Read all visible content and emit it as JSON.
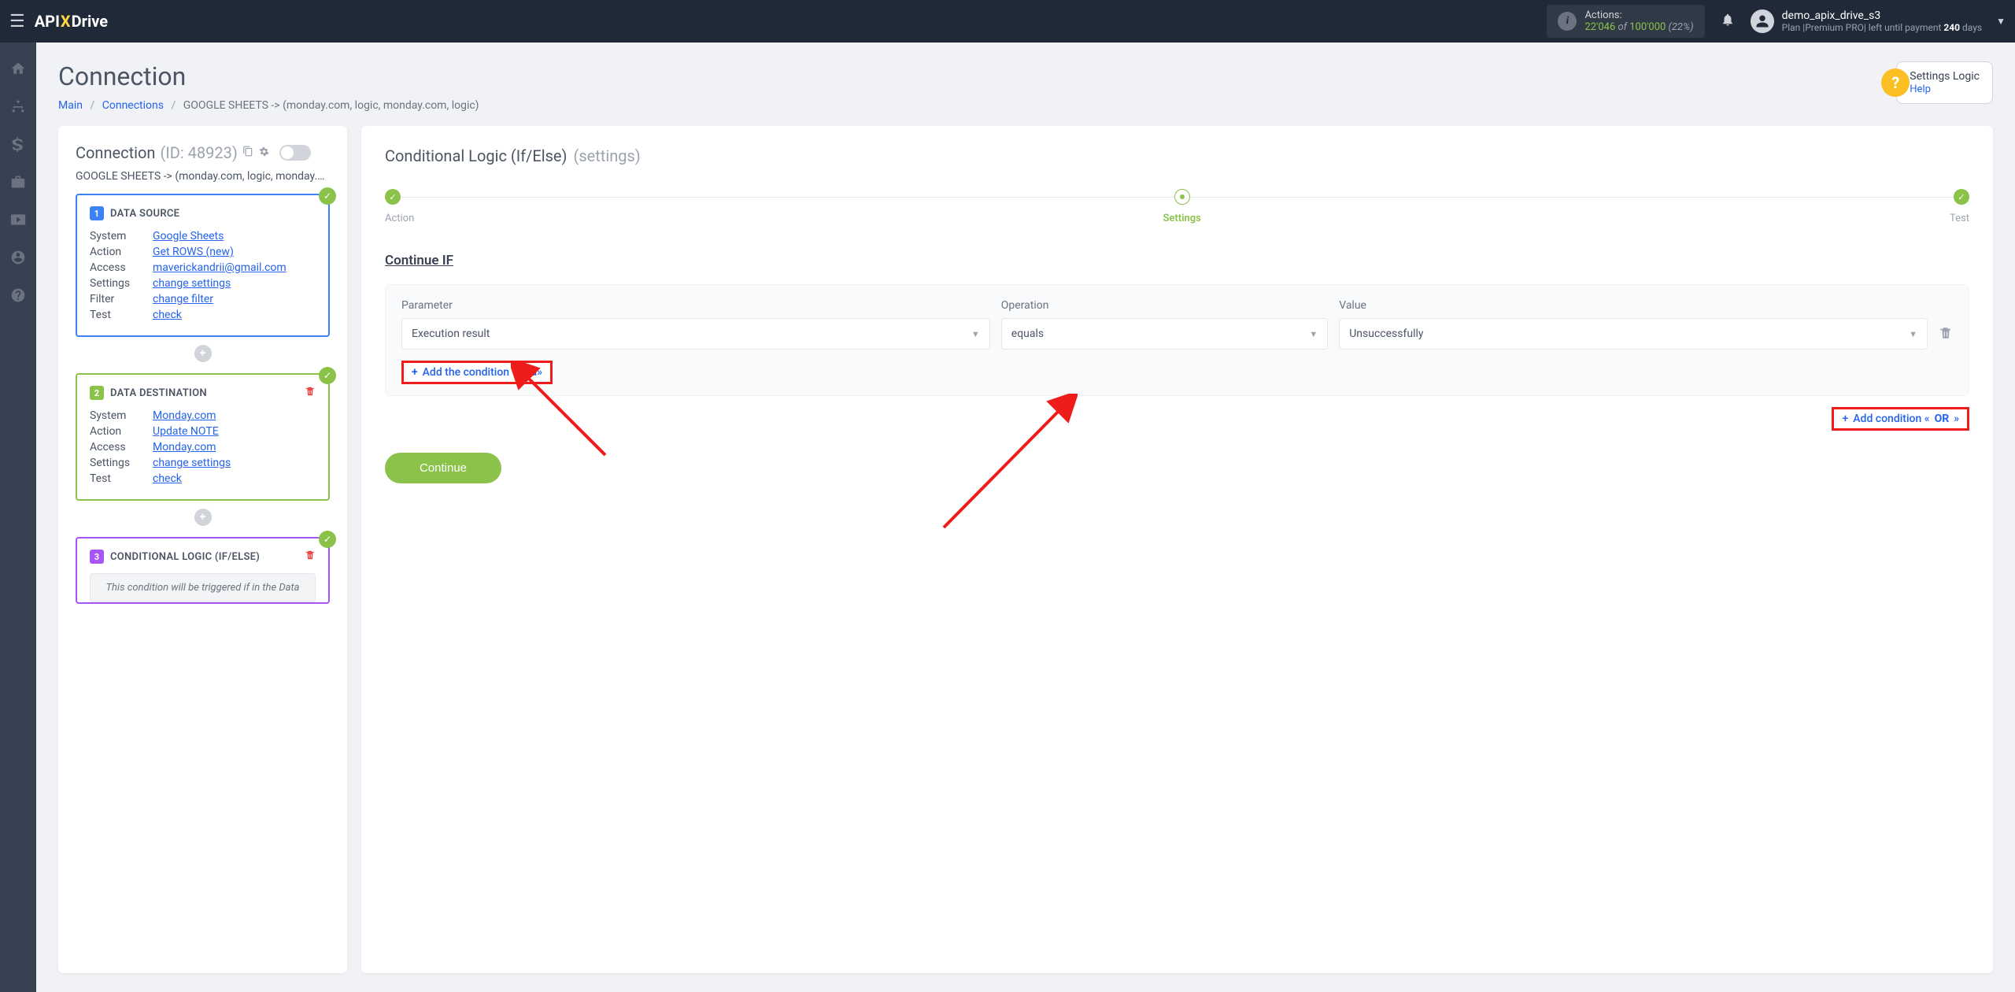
{
  "topbar": {
    "logo_pre": "API",
    "logo_x": "X",
    "logo_post": "Drive",
    "actions_label": "Actions:",
    "actions_used": "22'046",
    "actions_of": " of ",
    "actions_total": "100'000",
    "actions_pct": " (22%)",
    "user_name": "demo_apix_drive_s3",
    "user_plan_pre": "Plan |Premium PRO| left until payment ",
    "user_plan_days": "240",
    "user_plan_post": " days"
  },
  "page": {
    "title": "Connection",
    "breadcrumb": {
      "main": "Main",
      "connections": "Connections",
      "current": "GOOGLE SHEETS -> (monday.com, logic, monday.com, logic)"
    }
  },
  "help_box": {
    "title": "Settings Logic",
    "link": "Help"
  },
  "left_panel": {
    "title": "Connection",
    "id": "(ID: 48923)",
    "sub_name": "GOOGLE SHEETS -> (monday.com, logic, monday.com, logic)",
    "cards": {
      "source": {
        "num": "1",
        "title": "DATA SOURCE",
        "rows": [
          {
            "label": "System",
            "value": "Google Sheets"
          },
          {
            "label": "Action",
            "value": "Get ROWS (new)"
          },
          {
            "label": "Access",
            "value": "maverickandrii@gmail.com"
          },
          {
            "label": "Settings",
            "value": "change settings"
          },
          {
            "label": "Filter",
            "value": "change filter"
          },
          {
            "label": "Test",
            "value": "check"
          }
        ]
      },
      "dest": {
        "num": "2",
        "title": "DATA DESTINATION",
        "rows": [
          {
            "label": "System",
            "value": "Monday.com"
          },
          {
            "label": "Action",
            "value": "Update NOTE"
          },
          {
            "label": "Access",
            "value": "Monday.com"
          },
          {
            "label": "Settings",
            "value": "change settings"
          },
          {
            "label": "Test",
            "value": "check"
          }
        ]
      },
      "logic": {
        "num": "3",
        "title": "CONDITIONAL LOGIC (IF/ELSE)",
        "body": "This condition will be triggered if in the Data"
      }
    }
  },
  "main_panel": {
    "title": "Conditional Logic (If/Else)",
    "title_sub": "(settings)",
    "steps": [
      {
        "label": "Action"
      },
      {
        "label": "Settings"
      },
      {
        "label": "Test"
      }
    ],
    "section_title": "Continue IF",
    "condition": {
      "parameter_label": "Parameter",
      "parameter_value": "Execution result",
      "operation_label": "Operation",
      "operation_value": "equals",
      "value_label": "Value",
      "value_value": "Unsuccessfully"
    },
    "add_and_label": "Add the condition «And»",
    "add_or_pre": "Add condition «",
    "add_or_bold": "OR",
    "add_or_post": "»",
    "continue_btn": "Continue"
  }
}
